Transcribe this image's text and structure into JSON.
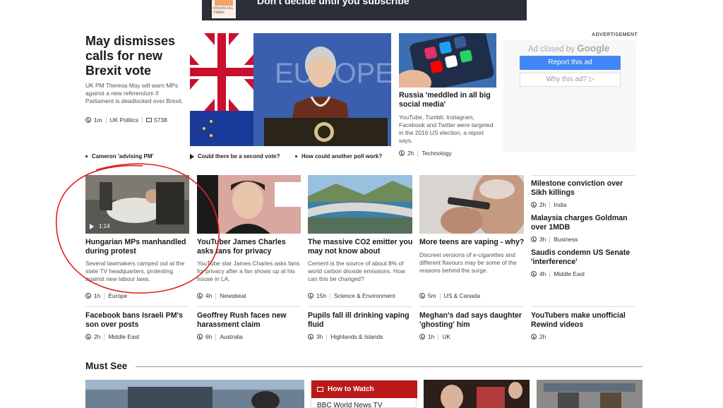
{
  "top_ad": {
    "logo_text": "FINANCIAL TIMES",
    "text": "Don't decide until you subscribe"
  },
  "lead": {
    "title": "May dismisses calls for new Brexit vote",
    "summary": "UK PM Theresa May will warn MPs against a new referendum if Parliament is deadlocked over Brexit.",
    "time": "1m",
    "section": "UK Politics",
    "comments": "5738",
    "related": [
      "Cameron 'advising PM'",
      "Could there be a second vote?",
      "How could another poll work?"
    ]
  },
  "russia_story": {
    "title": "Russia 'meddled in all big social media'",
    "summary": "YouTube, Tumblr, Instagram, Facebook and Twitter were targeted in the 2016 US election, a report says.",
    "time": "2h",
    "section": "Technology"
  },
  "advertisement": {
    "label": "ADVERTISEMENT",
    "closed_text": "Ad closed by",
    "google": "Google",
    "report_button": "Report this ad",
    "why_button": "Why this ad? ▷"
  },
  "grid": [
    {
      "title": "Hungarian MPs manhandled during protest",
      "summary": "Several lawmakers camped out at the state TV headquarters, protesting against new labour laws.",
      "time": "1h",
      "section": "Europe",
      "video_duration": "1:14"
    },
    {
      "title": "YouTuber James Charles asks fans for privacy",
      "summary": "YouTube star James Charles asks fans for privacy after a fan shows up at his house in LA.",
      "time": "4h",
      "section": "Newsbeat"
    },
    {
      "title": "The massive CO2 emitter you may not know about",
      "summary": "Cement is the source of about 8% of world carbon dioxide emissions. How can this be changed?",
      "time": "15h",
      "section": "Science & Environment"
    },
    {
      "title": "More teens are vaping - why?",
      "summary": "Discreet versions of e-cigarettes and different flavours may be some of the reasons behind the surge.",
      "time": "5m",
      "section": "US & Canada"
    }
  ],
  "side_list": [
    {
      "title": "Milestone conviction over Sikh killings",
      "time": "2h",
      "section": "India"
    },
    {
      "title": "Malaysia charges Goldman over 1MDB",
      "time": "3h",
      "section": "Business"
    },
    {
      "title": "Saudis condemn US Senate 'interference'",
      "time": "4h",
      "section": "Middle East"
    }
  ],
  "bottom_row": [
    {
      "title": "Facebook bans Israeli PM's son over posts",
      "time": "2h",
      "section": "Middle East"
    },
    {
      "title": "Geoffrey Rush faces new harassment claim",
      "time": "6h",
      "section": "Australia"
    },
    {
      "title": "Pupils fall ill drinking vaping fluid",
      "time": "3h",
      "section": "Highlands & Islands"
    },
    {
      "title": "Meghan's dad says daughter 'ghosting' him",
      "time": "1h",
      "section": "UK"
    },
    {
      "title": "YouTubers make unofficial Rewind videos",
      "time": "2h",
      "section": ""
    }
  ],
  "must_see": {
    "heading": "Must See",
    "how_to_watch": "How to Watch",
    "watch_sub": "BBC World News TV"
  },
  "colors": {
    "bbc_red": "#bb1919",
    "google_blue": "#4285f4",
    "annotation_red": "#e0201b"
  }
}
